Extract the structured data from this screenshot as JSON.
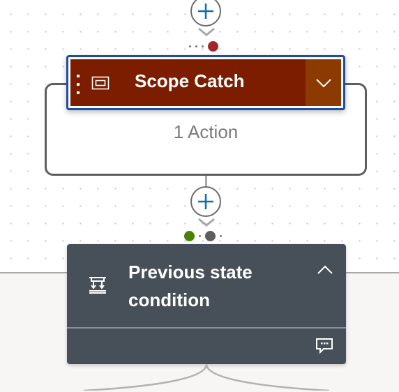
{
  "scope": {
    "title": "Scope Catch",
    "subtitle": "1 Action",
    "header_color": "#7c1d00",
    "expand_color": "#8c3a00",
    "selected_border": "#1f4da0"
  },
  "condition": {
    "title": "Previous state condition",
    "header_color": "#474f59"
  },
  "status": {
    "failed_color": "#a4262c",
    "succeeded_color": "#498205",
    "neutral_color": "#605e5c"
  },
  "icons": {
    "add": "plus-icon",
    "scope": "scope-icon",
    "condition": "condition-icon",
    "expand": "chevron-down-icon",
    "collapse": "chevron-up-icon",
    "comment": "comment-icon"
  },
  "accent_color": "#0f6cbd"
}
